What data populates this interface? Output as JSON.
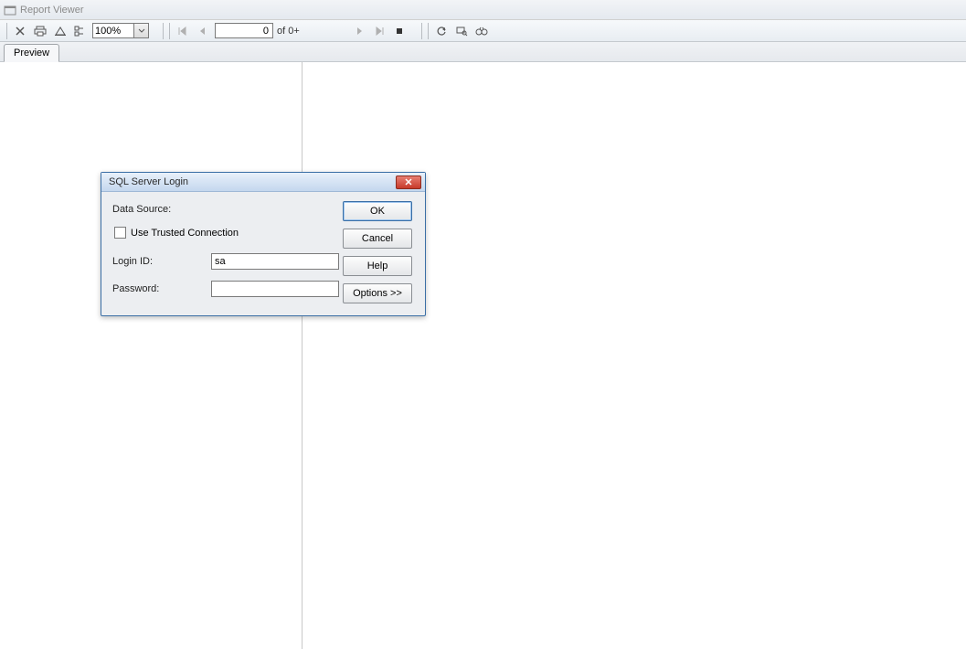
{
  "window": {
    "title": "Report Viewer"
  },
  "toolbar": {
    "zoom_value": "100%",
    "page_current": "0",
    "page_of_label": "of 0+"
  },
  "tabs": {
    "preview": "Preview"
  },
  "dialog": {
    "title": "SQL Server Login",
    "data_source_label": "Data Source:",
    "use_trusted_label": "Use Trusted Connection",
    "login_id_label": "Login ID:",
    "login_id_value": "sa",
    "password_label": "Password:",
    "password_value": "",
    "buttons": {
      "ok": "OK",
      "cancel": "Cancel",
      "help": "Help",
      "options": "Options >>"
    }
  }
}
